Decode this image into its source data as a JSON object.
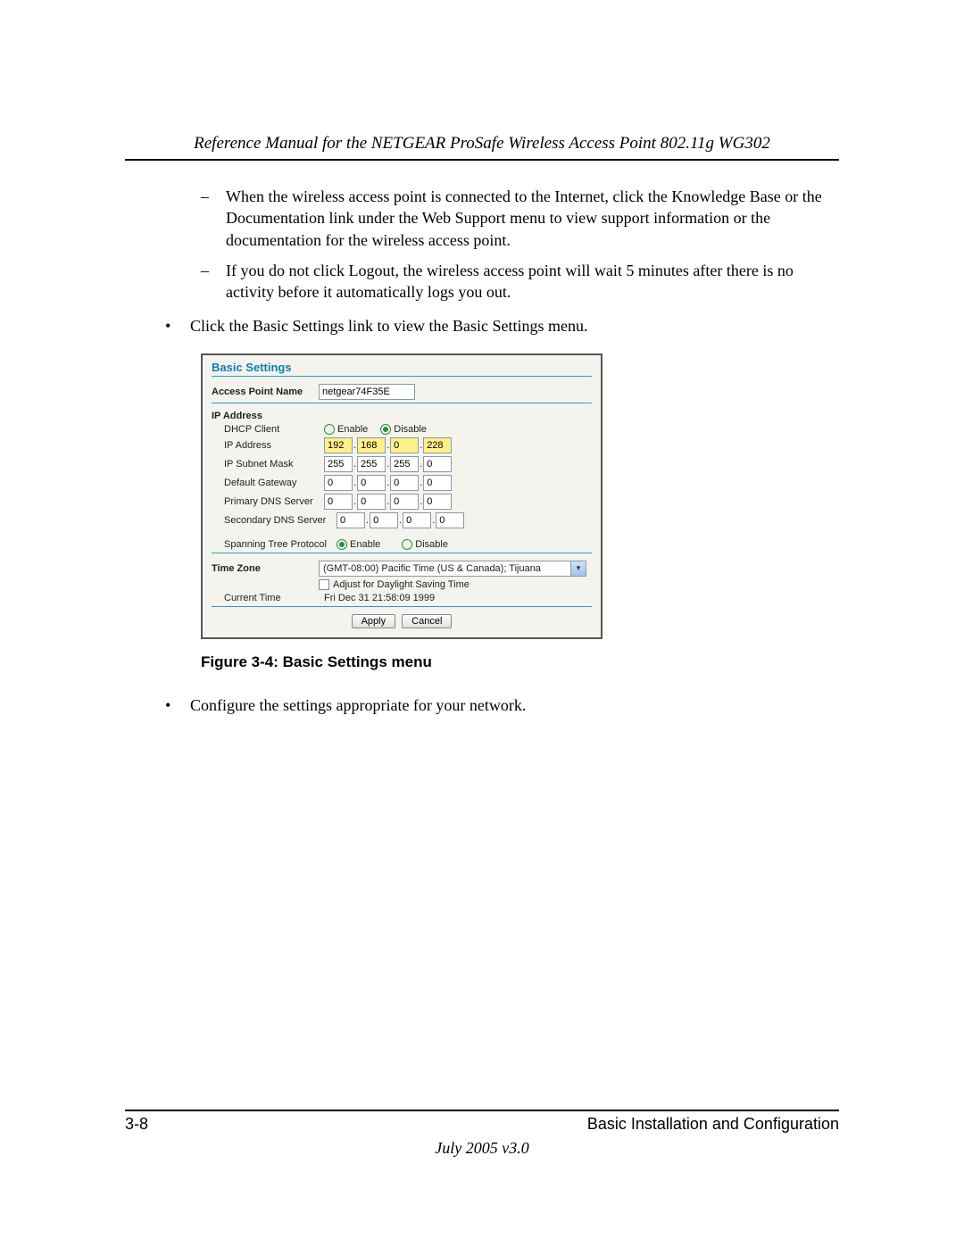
{
  "header": {
    "title": "Reference Manual for the NETGEAR ProSafe Wireless Access Point 802.11g WG302"
  },
  "body": {
    "dash_items": [
      "When the wireless access point is connected to the Internet, click the Knowledge Base or the Documentation link under the Web Support menu to view support information or the documentation for the wireless access point.",
      "If you do not click Logout, the wireless access point will wait 5 minutes after there is no activity before it automatically logs you out."
    ],
    "bullet_before_figure": "Click the Basic Settings link to view the Basic Settings menu.",
    "figure_caption": "Figure 3-4: Basic Settings menu",
    "bullet_after_figure": "Configure the settings appropriate for your network."
  },
  "figure": {
    "title": "Basic Settings",
    "apn_label": "Access Point Name",
    "apn_value": "netgear74F35E",
    "ip_heading": "IP Address",
    "dhcp_label": "DHCP Client",
    "enable_label": "Enable",
    "disable_label": "Disable",
    "dhcp_selected": "Disable",
    "ip_addr_label": "IP Address",
    "ip_addr": [
      "192",
      "168",
      "0",
      "228"
    ],
    "subnet_label": "IP Subnet Mask",
    "subnet": [
      "255",
      "255",
      "255",
      "0"
    ],
    "gateway_label": "Default Gateway",
    "gateway": [
      "0",
      "0",
      "0",
      "0"
    ],
    "pdns_label": "Primary DNS Server",
    "pdns": [
      "0",
      "0",
      "0",
      "0"
    ],
    "sdns_label": "Secondary DNS Server",
    "sdns": [
      "0",
      "0",
      "0",
      "0"
    ],
    "stp_label": "Spanning Tree Protocol",
    "stp_selected": "Enable",
    "tz_label": "Time Zone",
    "tz_value": "(GMT-08:00) Pacific Time (US & Canada); Tijuana",
    "dst_label": "Adjust for Daylight Saving Time",
    "dst_checked": false,
    "current_time_label": "Current Time",
    "current_time_value": "Fri Dec 31 21:58:09 1999",
    "apply_label": "Apply",
    "cancel_label": "Cancel"
  },
  "footer": {
    "page_number": "3-8",
    "section": "Basic Installation and Configuration",
    "version_line": "July 2005 v3.0"
  }
}
